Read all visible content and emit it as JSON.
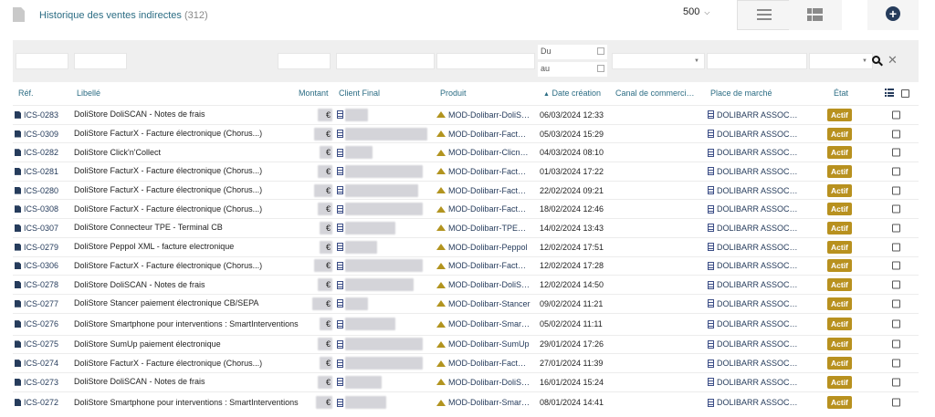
{
  "header": {
    "title": "Historique des ventes indirectes",
    "count": "(312)",
    "limit": "500"
  },
  "filters": {
    "date_from_placeholder": "Du",
    "date_to_placeholder": "au"
  },
  "columns": {
    "ref": "Réf.",
    "libelle": "Libellé",
    "montant": "Montant",
    "client": "Client Final",
    "produit": "Produit",
    "date": "Date création",
    "canal": "Canal de commerci…",
    "marche": "Place de marché",
    "etat": "État"
  },
  "rows": [
    {
      "ref": "ICS-0283",
      "libelle": "DoliStore DoliSCAN - Notes de frais",
      "produit": "MOD-Dolibarr-DoliS…",
      "date": "06/03/2024 12:33",
      "marche": "DOLIBARR ASSOC…",
      "etat": "Actif"
    },
    {
      "ref": "ICS-0309",
      "libelle": "DoliStore FacturX - Facture électronique (Chorus...)",
      "produit": "MOD-Dolibarr-Fact…",
      "date": "05/03/2024 15:29",
      "marche": "DOLIBARR ASSOC…",
      "etat": "Actif"
    },
    {
      "ref": "ICS-0282",
      "libelle": "DoliStore Click'n'Collect",
      "produit": "MOD-Dolibarr-Clicn…",
      "date": "04/03/2024 08:10",
      "marche": "DOLIBARR ASSOC…",
      "etat": "Actif"
    },
    {
      "ref": "ICS-0281",
      "libelle": "DoliStore FacturX - Facture électronique (Chorus...)",
      "produit": "MOD-Dolibarr-Fact…",
      "date": "01/03/2024 17:22",
      "marche": "DOLIBARR ASSOC…",
      "etat": "Actif"
    },
    {
      "ref": "ICS-0280",
      "libelle": "DoliStore FacturX - Facture électronique (Chorus...)",
      "produit": "MOD-Dolibarr-Fact…",
      "date": "22/02/2024 09:21",
      "marche": "DOLIBARR ASSOC…",
      "etat": "Actif"
    },
    {
      "ref": "ICS-0308",
      "libelle": "DoliStore FacturX - Facture électronique (Chorus...)",
      "produit": "MOD-Dolibarr-Fact…",
      "date": "18/02/2024 12:46",
      "marche": "DOLIBARR ASSOC…",
      "etat": "Actif"
    },
    {
      "ref": "ICS-0307",
      "libelle": "DoliStore Connecteur TPE - Terminal CB",
      "produit": "MOD-Dolibarr-TPE…",
      "date": "14/02/2024 13:43",
      "marche": "DOLIBARR ASSOC…",
      "etat": "Actif"
    },
    {
      "ref": "ICS-0279",
      "libelle": "DoliStore Peppol XML - facture electronique",
      "produit": "MOD-Dolibarr-Peppol",
      "date": "12/02/2024 17:51",
      "marche": "DOLIBARR ASSOC…",
      "etat": "Actif"
    },
    {
      "ref": "ICS-0306",
      "libelle": "DoliStore FacturX - Facture électronique (Chorus...)",
      "produit": "MOD-Dolibarr-Fact…",
      "date": "12/02/2024 17:28",
      "marche": "DOLIBARR ASSOC…",
      "etat": "Actif"
    },
    {
      "ref": "ICS-0278",
      "libelle": "DoliStore DoliSCAN - Notes de frais",
      "produit": "MOD-Dolibarr-DoliS…",
      "date": "12/02/2024 14:50",
      "marche": "DOLIBARR ASSOC…",
      "etat": "Actif"
    },
    {
      "ref": "ICS-0277",
      "libelle": "DoliStore Stancer paiement électronique CB/SEPA",
      "produit": "MOD-Dolibarr-Stancer",
      "date": "09/02/2024 11:21",
      "marche": "DOLIBARR ASSOC…",
      "etat": "Actif"
    },
    {
      "ref": "ICS-0276",
      "libelle": "DoliStore Smartphone pour interventions : SmartInterventions",
      "produit": "MOD-Dolibarr-Smar…",
      "date": "05/02/2024 11:11",
      "marche": "DOLIBARR ASSOC…",
      "etat": "Actif",
      "tall": true
    },
    {
      "ref": "ICS-0275",
      "libelle": "DoliStore SumUp paiement électronique",
      "produit": "MOD-Dolibarr-SumUp",
      "date": "29/01/2024 17:26",
      "marche": "DOLIBARR ASSOC…",
      "etat": "Actif"
    },
    {
      "ref": "ICS-0274",
      "libelle": "DoliStore FacturX - Facture électronique (Chorus...)",
      "produit": "MOD-Dolibarr-Fact…",
      "date": "27/01/2024 11:39",
      "marche": "DOLIBARR ASSOC…",
      "etat": "Actif"
    },
    {
      "ref": "ICS-0273",
      "libelle": "DoliStore DoliSCAN - Notes de frais",
      "produit": "MOD-Dolibarr-DoliS…",
      "date": "16/01/2024 15:24",
      "marche": "DOLIBARR ASSOC…",
      "etat": "Actif"
    },
    {
      "ref": "ICS-0272",
      "libelle": "DoliStore Smartphone pour interventions : SmartInterventions",
      "produit": "MOD-Dolibarr-Smar…",
      "date": "08/01/2024 14:41",
      "marche": "DOLIBARR ASSOC…",
      "etat": "Actif",
      "tall": true
    }
  ],
  "currency": "€",
  "colors": {
    "link": "#263c5c",
    "title": "#2c6d84",
    "badge": "#b8911f"
  },
  "icons": [
    "document-icon",
    "hamburger-icon",
    "kanban-icon",
    "plus-circle-icon",
    "search-icon",
    "clear-icon",
    "list-settings-icon",
    "building-icon",
    "product-icon"
  ]
}
